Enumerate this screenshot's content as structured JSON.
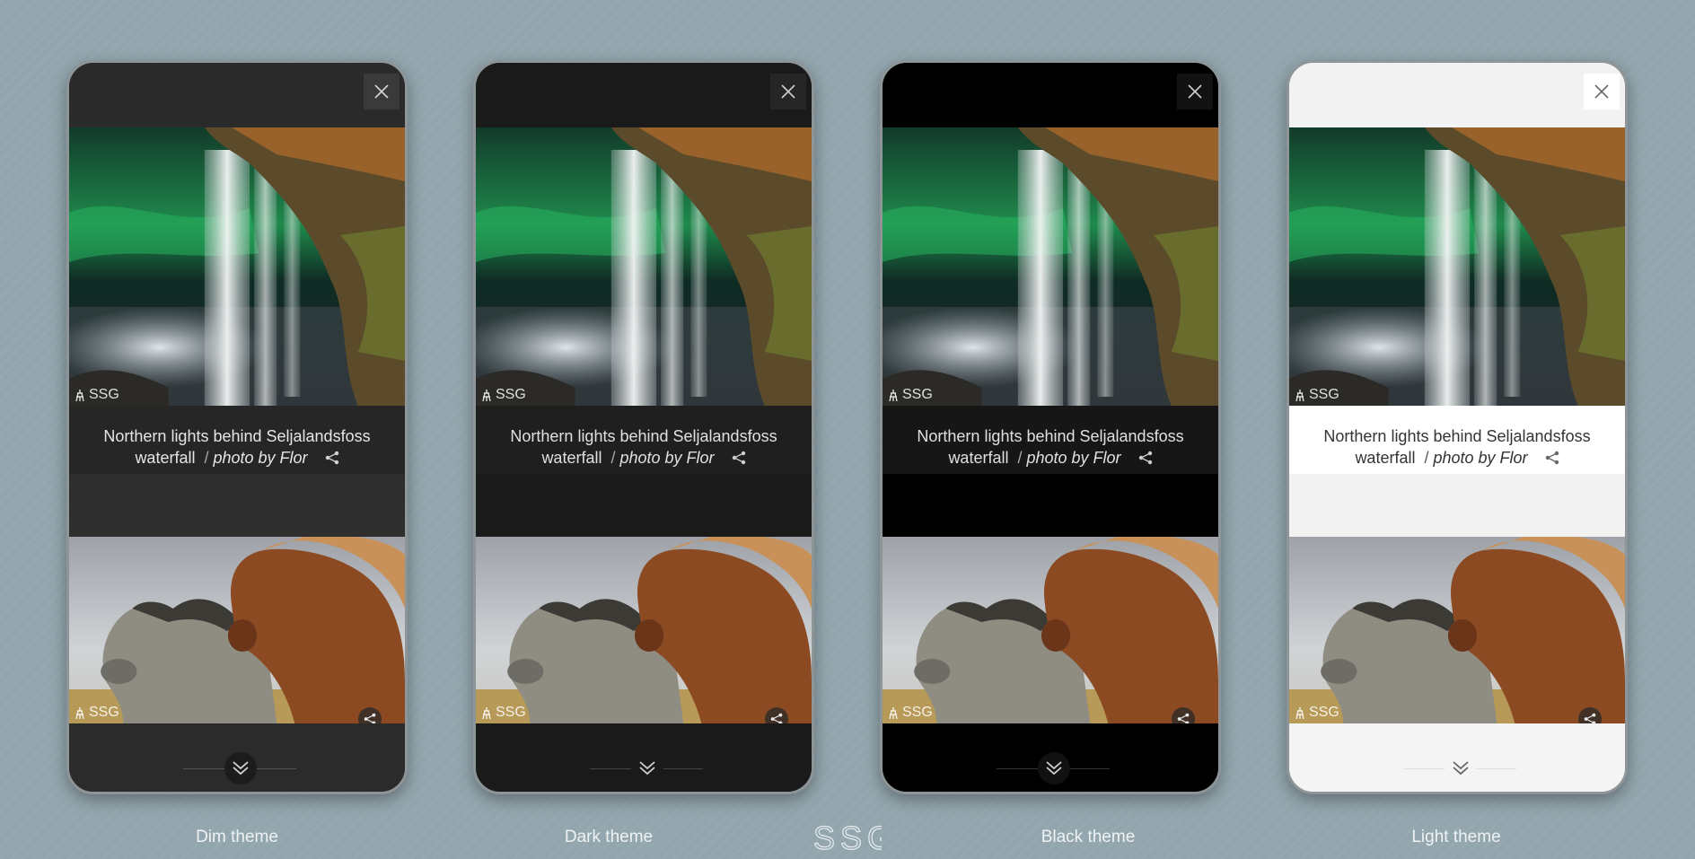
{
  "themes": [
    {
      "label": "Dim theme",
      "colors": {
        "bar": "#2a2a2b",
        "caption_bg": "#262627",
        "gap": "#2e2e2f",
        "bottom": "#2b2b2c",
        "text": "#e6e6e6",
        "muted": "#a9a9a9",
        "close_bg": "#3a3a3b",
        "icon": "#d4d4d4",
        "scroll_bg": "#1c1c1d",
        "line": "#555"
      }
    },
    {
      "label": "Dark theme",
      "colors": {
        "bar": "#1a1a1a",
        "caption_bg": "#1f1f1f",
        "gap": "#1a1a1a",
        "bottom": "#1a1a1a",
        "text": "#e0e0e0",
        "muted": "#a9a9a9",
        "close_bg": "#262626",
        "icon": "#cfcfcf",
        "scroll_bg": "#1a1a1a",
        "line": "#444"
      }
    },
    {
      "label": "Black theme",
      "colors": {
        "bar": "#000000",
        "caption_bg": "#161616",
        "gap": "#000000",
        "bottom": "#000000",
        "text": "#e0e0e0",
        "muted": "#a9a9a9",
        "close_bg": "#121212",
        "icon": "#cfcfcf",
        "scroll_bg": "#111111",
        "line": "#333"
      }
    },
    {
      "label": "Light theme",
      "colors": {
        "bar": "#f2f2f2",
        "caption_bg": "#ffffff",
        "gap": "#f2f2f2",
        "bottom": "#f4f4f4",
        "text": "#333333",
        "muted": "#555555",
        "close_bg": "#ffffff",
        "icon": "#666666",
        "scroll_bg": "#f4f4f4",
        "line": "#dddddd"
      }
    }
  ],
  "photo1": {
    "title": "Northern lights behind Seljalandsfoss",
    "title_line2": "waterfall",
    "separator": "/",
    "credit": "photo by Flor"
  },
  "watermark": "SSG",
  "logo": "SSG",
  "icons": {
    "close": "close-icon",
    "share": "share-icon",
    "scroll": "chevron-double-down-icon",
    "watermark": "ssg-logo-icon"
  }
}
